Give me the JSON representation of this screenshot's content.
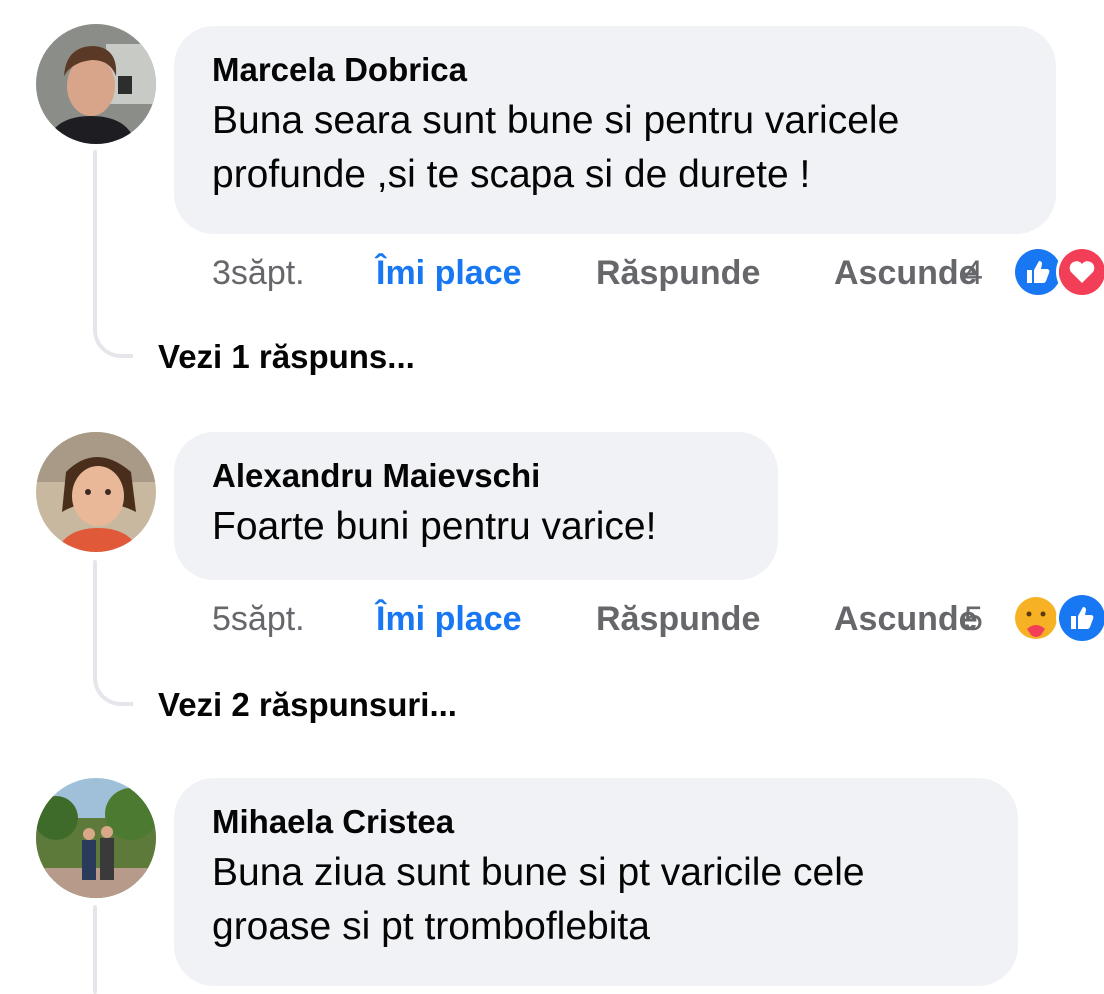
{
  "comments": [
    {
      "author": "Marcela Dobrica",
      "text_line1": "Buna seara sunt bune si pentru varicele",
      "text_line2": "profunde ,si te scapa si de durete !",
      "time": "3săpt.",
      "like": "Îmi place",
      "reply": "Răspunde",
      "hide": "Ascunde",
      "reaction_count": "4",
      "reactions": [
        "like-icon",
        "love-icon"
      ],
      "view_replies": "Vezi 1 răspuns..."
    },
    {
      "author": "Alexandru Maievschi",
      "text_line1": "Foarte buni pentru varice!",
      "time": "5săpt.",
      "like": "Îmi place",
      "reply": "Răspunde",
      "hide": "Ascunde",
      "reaction_count": "5",
      "reactions": [
        "care-icon",
        "like-icon"
      ],
      "view_replies": "Vezi 2 răspunsuri..."
    },
    {
      "author": "Mihaela Cristea",
      "text_line1": "Buna ziua sunt bune si pt varicile cele",
      "text_line2": "groase si pt tromboflebita"
    }
  ],
  "colors": {
    "accent": "#1877f2",
    "love": "#f33e58",
    "care": "#f7b125",
    "bubble": "#f0f2f5",
    "secondary_text": "#65676b"
  }
}
